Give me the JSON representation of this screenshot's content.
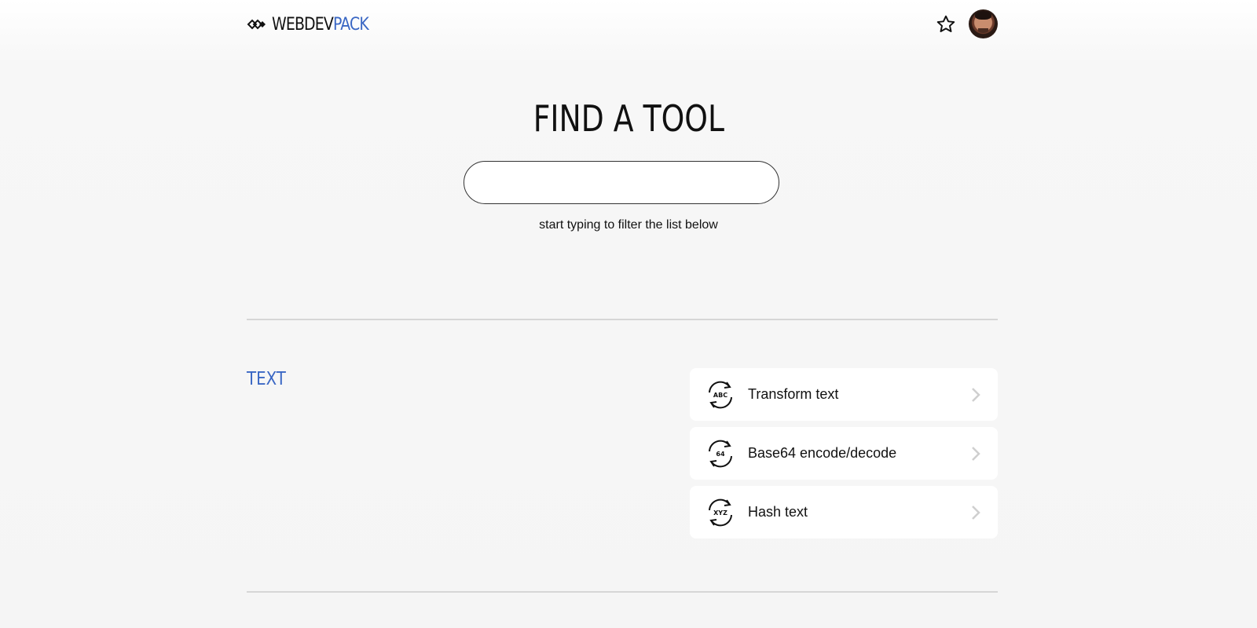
{
  "header": {
    "logo_primary": "WEBDEV",
    "logo_accent": "PACK",
    "logo_icon": "diamond-logo-icon",
    "favorite_icon": "star-icon",
    "avatar": "user-avatar"
  },
  "hero": {
    "title": "FIND A TOOL",
    "search_value": "",
    "hint": "start typing to filter the list below"
  },
  "sections": [
    {
      "title": "TEXT",
      "tools": [
        {
          "label": "Transform text",
          "icon_text": "ABC",
          "icon": "transform-text-icon"
        },
        {
          "label": "Base64 encode/decode",
          "icon_text": "64",
          "icon": "base64-icon"
        },
        {
          "label": "Hash text",
          "icon_text": "XYZ",
          "icon": "hash-text-icon"
        }
      ]
    }
  ],
  "colors": {
    "accent": "#3a67c4",
    "background": "#f5f5f5",
    "card": "#ffffff",
    "divider": "#d6d6d6",
    "chevron": "#cfcfcf"
  }
}
